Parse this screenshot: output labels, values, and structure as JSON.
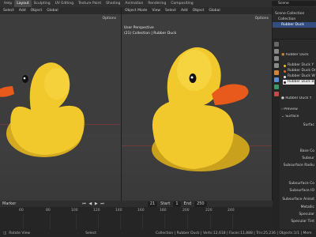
{
  "topbar": {
    "tabs": [
      "Help",
      "Layout",
      "Sculpting",
      "UV Editing",
      "Texture Paint",
      "Shading",
      "Animation",
      "Rendering",
      "Compositing"
    ],
    "active_tab": "Layout",
    "scene": "Scene"
  },
  "viewport_left": {
    "menu": [
      "Select",
      "Add",
      "Object"
    ],
    "orientation": "Global",
    "options": "Options"
  },
  "viewport_right": {
    "mode": "Object Mode",
    "menu": [
      "View",
      "Select",
      "Add",
      "Object"
    ],
    "orientation": "Global",
    "options": "Options",
    "view_name": "User Perspective",
    "collection_label": "(21) Collection | Rubber Duck"
  },
  "outliner": {
    "rows": [
      "Scene Collection",
      "Collection",
      "Rubber Duck"
    ]
  },
  "properties": {
    "object_name": "Rubber Duck",
    "material_slots": [
      {
        "label": "Rubber Duck Y",
        "color": "#e7c22a"
      },
      {
        "label": "Rubber Duck Or",
        "color": "#e0651c"
      },
      {
        "label": "Rubber Duck W",
        "color": "#eeeeee"
      },
      {
        "label": "Rubber Duck B",
        "color": "#222222"
      }
    ],
    "active_material": "Rubber Duck Y",
    "sections": [
      "Preview",
      "Surface"
    ],
    "surface_label": "Surface",
    "params": [
      "Base Co",
      "Subsur",
      "Subsurface Radiu",
      "Subsurface Co",
      "Subsurface IO",
      "Subsurface Anisot",
      "Metallic",
      "Specular",
      "Specular Tint"
    ],
    "top_param": "Surfac"
  },
  "timeline": {
    "menu": [
      "Marker"
    ],
    "ticks": [
      "60",
      "80",
      "100",
      "120",
      "140",
      "160",
      "180",
      "200",
      "220",
      "240"
    ],
    "current_frame": "21",
    "start_label": "Start",
    "start_value": "1",
    "end_label": "End",
    "end_value": "250"
  },
  "statusbar": {
    "left": "Rotate View",
    "middle": "Select",
    "right": "Collection | Rubber Duck | Verts:12,618 | Faces:11,888 | Tris:25,236 | Objects:1/1 | Mem"
  },
  "colors": {
    "duck_body": "#f2c92d",
    "duck_beak": "#e8591c",
    "accent_blue": "#3d6fd0"
  }
}
